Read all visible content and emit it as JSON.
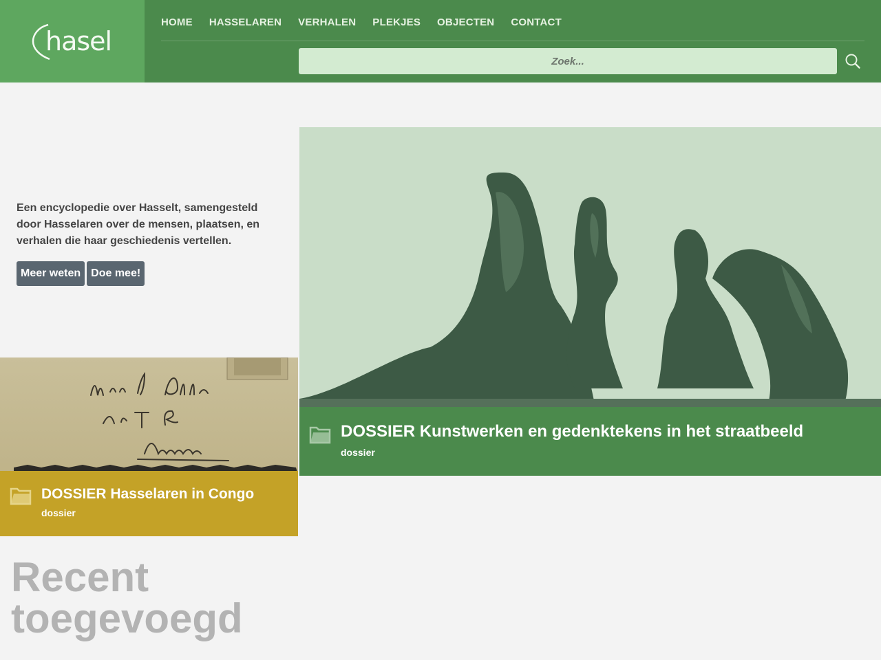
{
  "logo": {
    "text": "hasel"
  },
  "nav": {
    "items": [
      "HOME",
      "HASSELAREN",
      "VERHALEN",
      "PLEKJES",
      "OBJECTEN",
      "CONTACT"
    ]
  },
  "search": {
    "placeholder": "Zoek...",
    "icon": "search-icon"
  },
  "intro": {
    "text": "Een encyclopedie over Hasselt, samengesteld door Hasselaren over de mensen, plaatsen, en verhalen die haar geschiedenis vertellen.",
    "buttons": [
      "Meer weten",
      "Doe mee!"
    ]
  },
  "cards": [
    {
      "title": "DOSSIER Hasselaren in Congo",
      "type": "dossier",
      "icon": "folder-icon",
      "color": "#c4a227"
    },
    {
      "title": "DOSSIER Kunstwerken en gedenktekens in het straatbeeld",
      "type": "dossier",
      "icon": "folder-icon",
      "color": "#4b8a4c"
    }
  ],
  "recent": {
    "heading": "Recent toegevoegd"
  },
  "colors": {
    "header": "#4b8a4c",
    "logo_bg": "#5ea75f",
    "search_bg": "#d3ebd1",
    "button": "#5a6670"
  }
}
